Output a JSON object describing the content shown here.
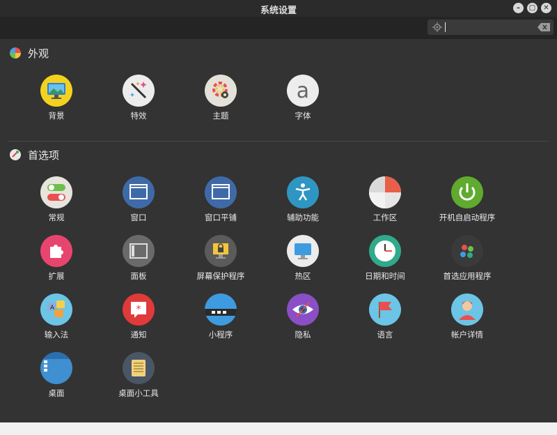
{
  "window": {
    "title": "系统设置"
  },
  "search": {
    "placeholder": "",
    "value": ""
  },
  "sections": [
    {
      "title": "外观",
      "items": [
        {
          "label": "背景",
          "icon": "background-icon"
        },
        {
          "label": "特效",
          "icon": "effects-icon"
        },
        {
          "label": "主题",
          "icon": "themes-icon"
        },
        {
          "label": "字体",
          "icon": "fonts-icon"
        }
      ]
    },
    {
      "title": "首选项",
      "items": [
        {
          "label": "常规",
          "icon": "general-icon"
        },
        {
          "label": "窗口",
          "icon": "windows-icon"
        },
        {
          "label": "窗口平铺",
          "icon": "window-tiling-icon"
        },
        {
          "label": "辅助功能",
          "icon": "accessibility-icon"
        },
        {
          "label": "工作区",
          "icon": "workspaces-icon"
        },
        {
          "label": "开机自启动程序",
          "icon": "startup-apps-icon"
        },
        {
          "label": "扩展",
          "icon": "extensions-icon"
        },
        {
          "label": "面板",
          "icon": "panel-icon"
        },
        {
          "label": "屏幕保护程序",
          "icon": "screensaver-icon"
        },
        {
          "label": "热区",
          "icon": "hot-corners-icon"
        },
        {
          "label": "日期和时间",
          "icon": "date-time-icon"
        },
        {
          "label": "首选应用程序",
          "icon": "preferred-apps-icon"
        },
        {
          "label": "输入法",
          "icon": "input-method-icon"
        },
        {
          "label": "通知",
          "icon": "notifications-icon"
        },
        {
          "label": "小程序",
          "icon": "applets-icon"
        },
        {
          "label": "隐私",
          "icon": "privacy-icon"
        },
        {
          "label": "语言",
          "icon": "languages-icon"
        },
        {
          "label": "帐户详情",
          "icon": "account-details-icon"
        },
        {
          "label": "桌面",
          "icon": "desktop-icon"
        },
        {
          "label": "桌面小工具",
          "icon": "desklets-icon"
        }
      ]
    }
  ]
}
